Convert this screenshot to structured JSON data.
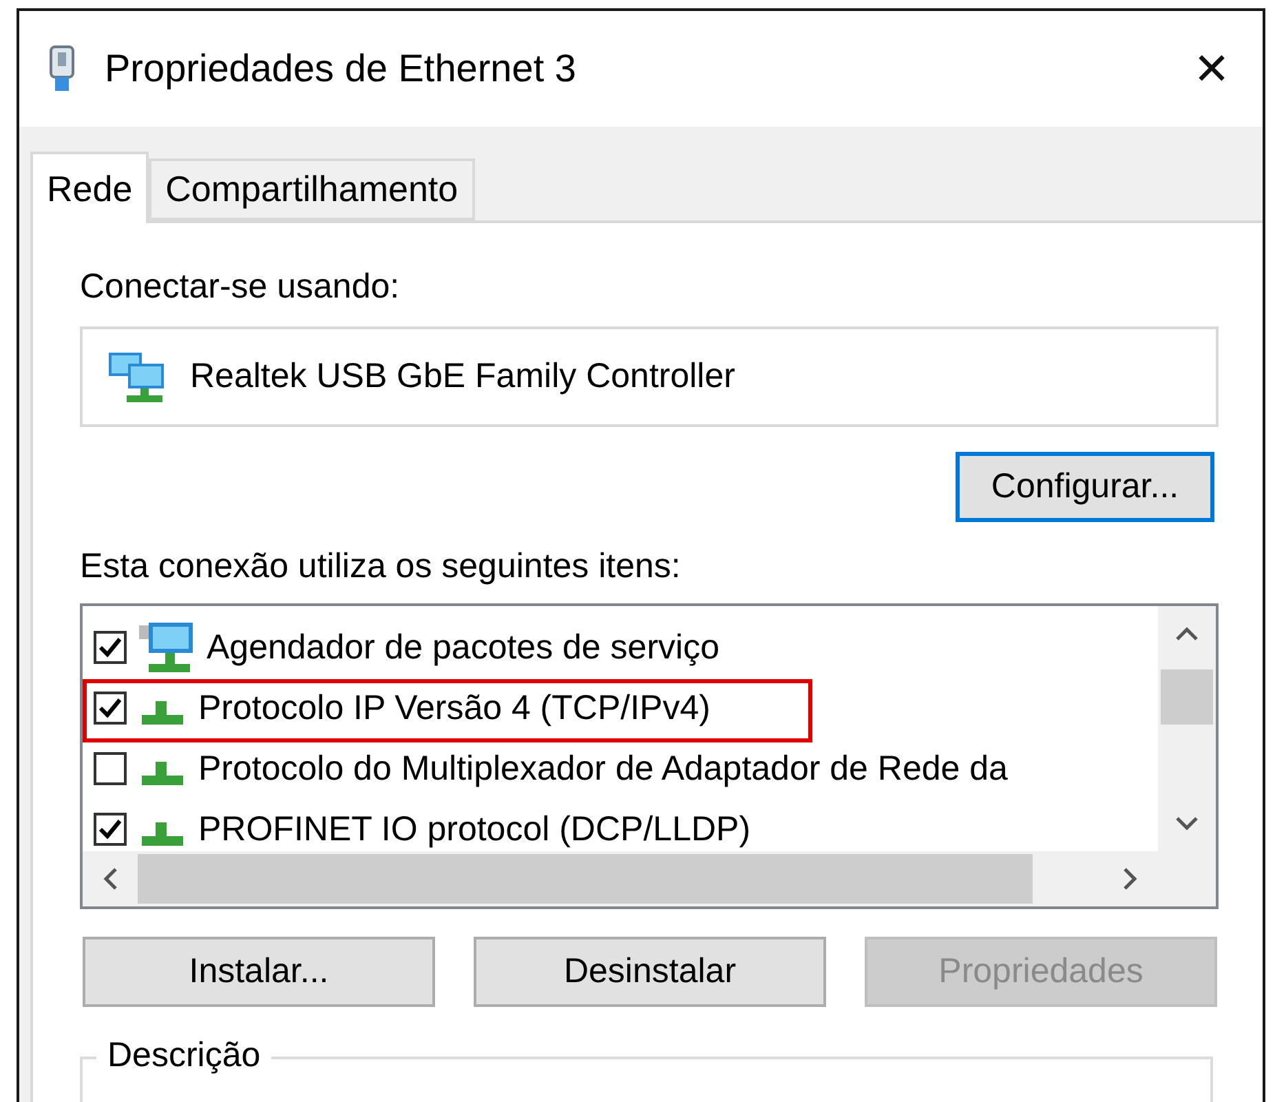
{
  "window": {
    "title": "Propriedades de Ethernet 3",
    "close": "✕"
  },
  "tabs": [
    {
      "label": "Rede",
      "selected": true
    },
    {
      "label": "Compartilhamento",
      "selected": false
    }
  ],
  "connect_label": "Conectar-se usando:",
  "adapter": "Realtek USB GbE Family Controller",
  "configure_button": "Configurar...",
  "items_label": "Esta conexão utiliza os seguintes itens:",
  "items": [
    {
      "label": "Agendador de pacotes de serviço",
      "checked": true,
      "kind": "service",
      "highlighted": false
    },
    {
      "label": "Protocolo IP Versão 4 (TCP/IPv4)",
      "checked": true,
      "kind": "protocol",
      "highlighted": true
    },
    {
      "label": "Protocolo do Multiplexador de Adaptador de Rede da",
      "checked": false,
      "kind": "protocol",
      "highlighted": false
    },
    {
      "label": "PROFINET IO protocol (DCP/LLDP)",
      "checked": true,
      "kind": "protocol",
      "highlighted": false
    }
  ],
  "buttons": [
    {
      "label": "Instalar...",
      "disabled": false
    },
    {
      "label": "Desinstalar",
      "disabled": false
    },
    {
      "label": "Propriedades",
      "disabled": true
    }
  ],
  "description": {
    "title": "Descrição"
  }
}
